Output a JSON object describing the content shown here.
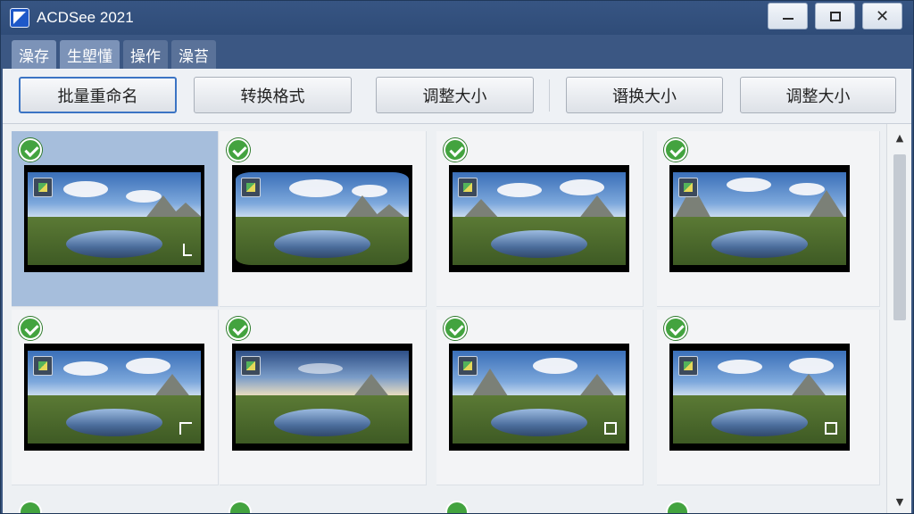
{
  "window": {
    "title": "ACDSee 2021",
    "icon": "acdsee-app-icon",
    "controls": {
      "minimize": "minimize",
      "maximize": "maximize",
      "close": "✕"
    }
  },
  "menu": {
    "tabs": [
      {
        "label": "澡存",
        "active": true
      },
      {
        "label": "生塱懂",
        "active": true
      },
      {
        "label": "操作",
        "active": false
      },
      {
        "label": "澡苔",
        "active": false
      }
    ]
  },
  "toolbar": {
    "buttons": [
      {
        "label": "批量重命名",
        "primary": true
      },
      {
        "label": "转换格式",
        "primary": false
      },
      {
        "label": "调整大小",
        "primary": false
      },
      {
        "label": "谮换大小",
        "primary": false
      },
      {
        "label": "调整大小",
        "primary": false
      }
    ]
  },
  "grid": {
    "items": [
      {
        "checked": true,
        "selected": true,
        "badge": "edit-badge-icon",
        "corner": "crop-corner-icon"
      },
      {
        "checked": true,
        "selected": false,
        "badge": "document-badge-icon",
        "corner": ""
      },
      {
        "checked": true,
        "selected": false,
        "badge": "export-badge-icon",
        "corner": ""
      },
      {
        "checked": true,
        "selected": false,
        "badge": "document-badge-icon",
        "corner": ""
      },
      {
        "checked": true,
        "selected": false,
        "badge": "export-badge-icon",
        "corner": "crop-corner-icon"
      },
      {
        "checked": true,
        "selected": false,
        "badge": "frame-badge-icon",
        "corner": ""
      },
      {
        "checked": true,
        "selected": false,
        "badge": "export-badge-icon",
        "corner": "frame-corner-icon"
      },
      {
        "checked": true,
        "selected": false,
        "badge": "document-badge-icon",
        "corner": "frame-corner-icon"
      }
    ]
  },
  "scrollbar": {
    "up_arrow": "▲",
    "down_arrow": "▼"
  },
  "colors": {
    "title_bg": "#2f4c78",
    "selection": "#a6bedc",
    "check": "#43a33f"
  }
}
